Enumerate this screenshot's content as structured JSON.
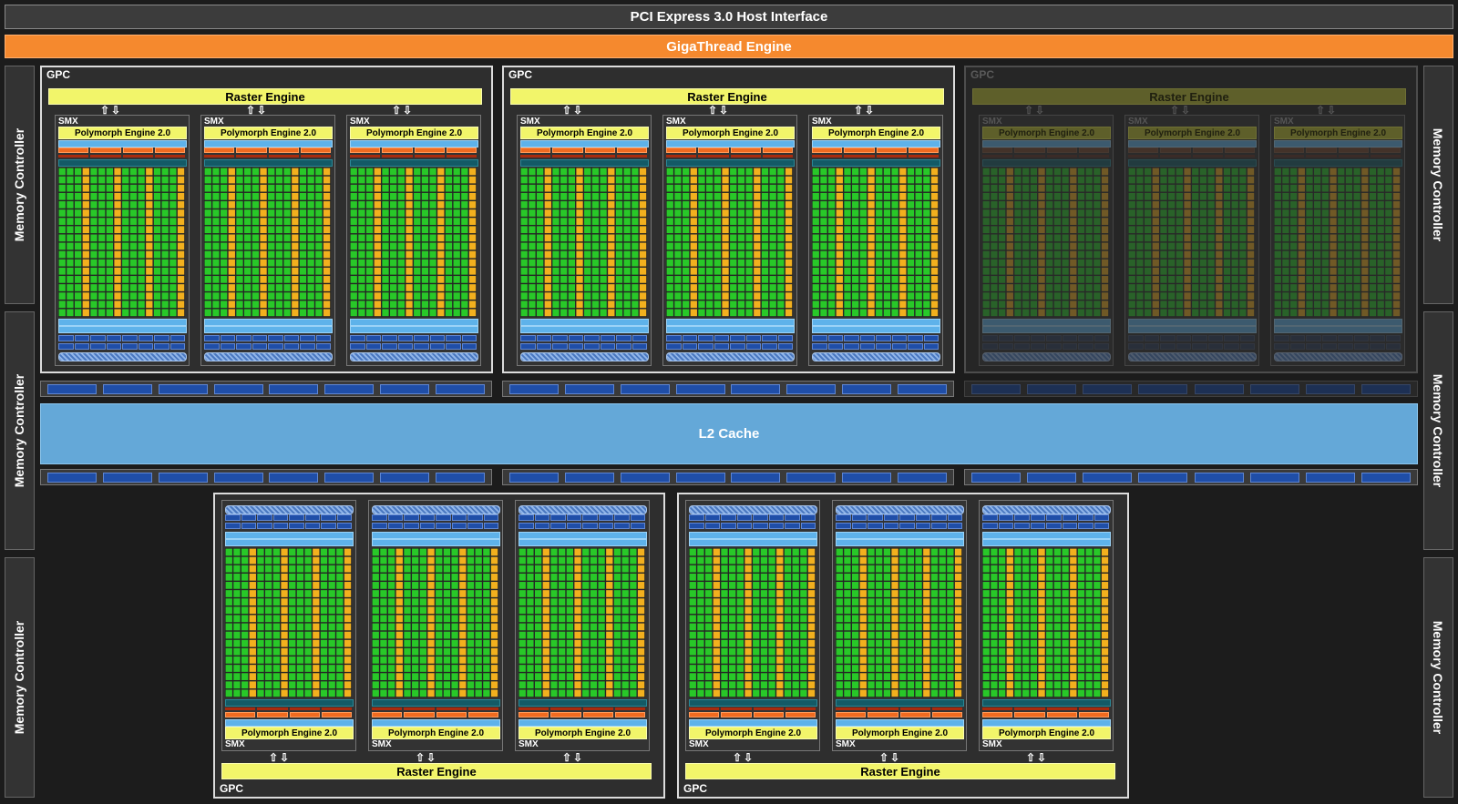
{
  "header": {
    "pcie": "PCI Express 3.0 Host Interface",
    "gigathread": "GigaThread Engine"
  },
  "memory_controller_label": "Memory Controller",
  "l2_label": "L2 Cache",
  "gpc_label": "GPC",
  "raster_label": "Raster Engine",
  "smx_label": "SMX",
  "polymorph_label": "Polymorph Engine 2.0",
  "arrows": "⇧⇩",
  "colors": {
    "core": "#28c828",
    "special": "#f2b01e",
    "orange": "#f5892e",
    "yellow": "#f2f56a",
    "l2": "#64a8d8",
    "blue": "#1f4ea8"
  },
  "gpcs": [
    {
      "id": "gpc-top-1",
      "status": "enabled",
      "smx_count": 3
    },
    {
      "id": "gpc-top-2",
      "status": "enabled",
      "smx_count": 3
    },
    {
      "id": "gpc-top-3",
      "status": "disabled",
      "smx_count": 3
    },
    {
      "id": "gpc-bottom-1",
      "status": "enabled",
      "smx_count": 3
    },
    {
      "id": "gpc-bottom-2",
      "status": "enabled",
      "smx_count": 3
    }
  ]
}
